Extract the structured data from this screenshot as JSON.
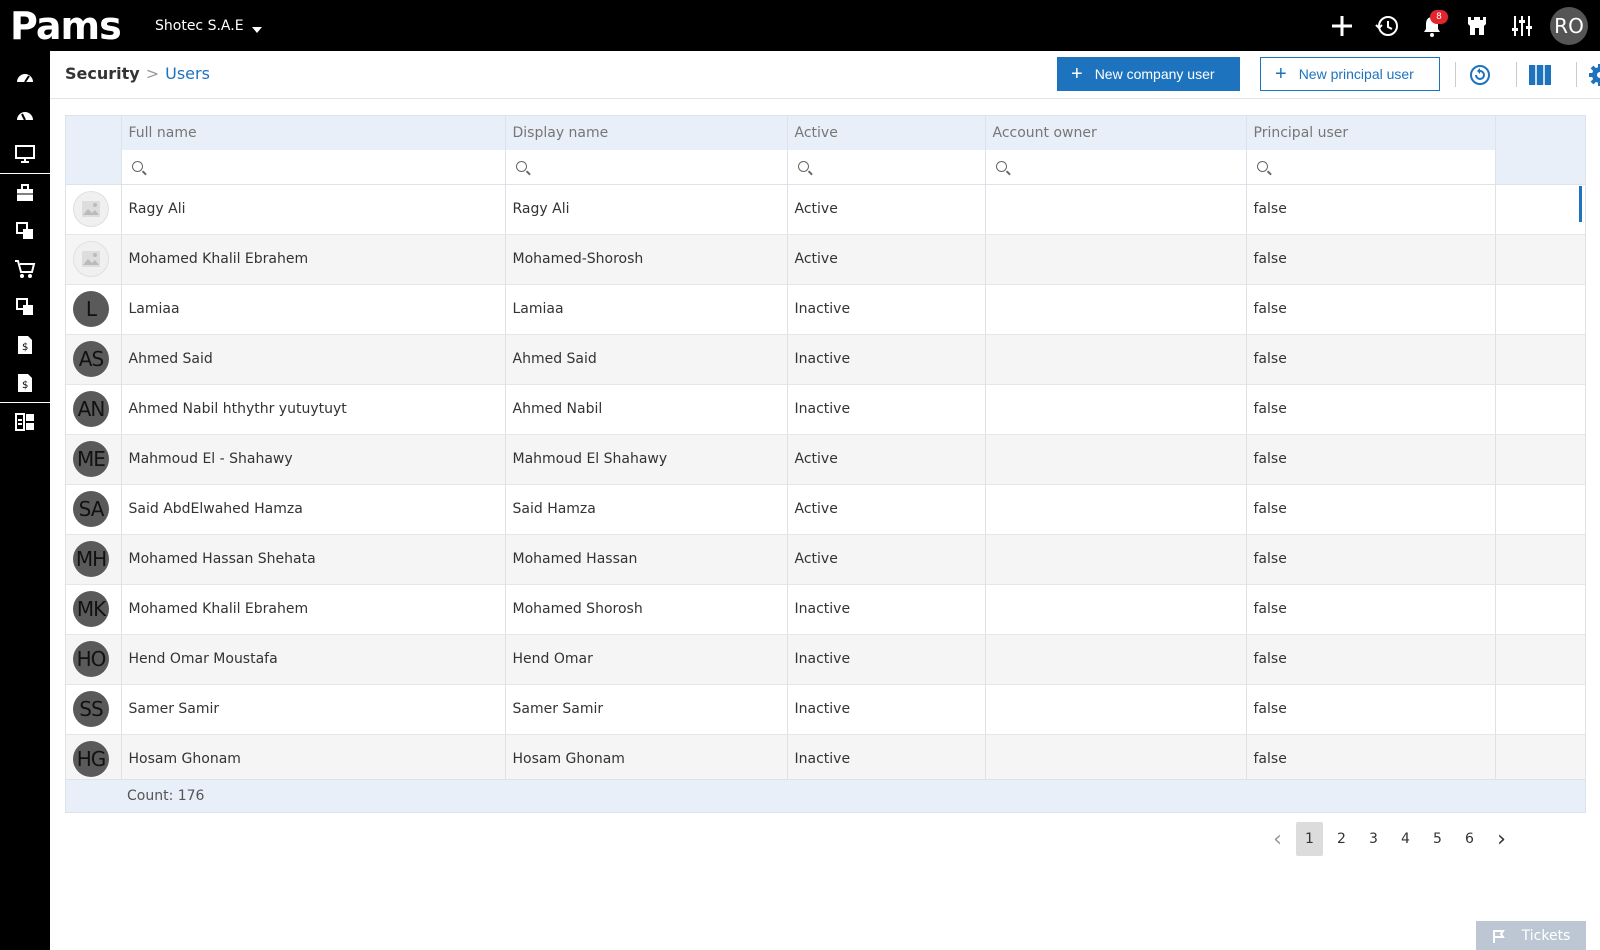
{
  "app": {
    "logo_text": "Pams",
    "company": "Shotec S.A.E",
    "notifications_count": "8",
    "user_initials": "RO"
  },
  "breadcrumb": {
    "root": "Security",
    "separator": ">",
    "current": "Users"
  },
  "toolbar": {
    "new_company_user": "New company user",
    "new_principal_user": "New principal user",
    "plus": "+"
  },
  "sidebar_icons": [
    "dashboard-icon",
    "dashboard-alt-icon",
    "monitor-icon",
    "briefcase-icon",
    "modules-icon",
    "cart-icon",
    "modules-alt-icon",
    "invoice-icon",
    "invoice-alt-icon",
    "widgets-icon"
  ],
  "table": {
    "columns": [
      "Full name",
      "Display name",
      "Active",
      "Account owner",
      "Principal user"
    ],
    "rows": [
      {
        "avatar": "",
        "avatar_type": "image",
        "full_name": "Ragy Ali",
        "display_name": "Ragy Ali",
        "active": "Active",
        "account_owner": "",
        "principal": "false"
      },
      {
        "avatar": "",
        "avatar_type": "image",
        "full_name": "Mohamed Khalil Ebrahem",
        "display_name": "Mohamed-Shorosh",
        "active": "Active",
        "account_owner": "",
        "principal": "false"
      },
      {
        "avatar": "L",
        "avatar_type": "initials",
        "full_name": "Lamiaa",
        "display_name": "Lamiaa",
        "active": "Inactive",
        "account_owner": "",
        "principal": "false"
      },
      {
        "avatar": "AS",
        "avatar_type": "initials",
        "full_name": "Ahmed Said",
        "display_name": "Ahmed Said",
        "active": "Inactive",
        "account_owner": "",
        "principal": "false"
      },
      {
        "avatar": "AN",
        "avatar_type": "initials",
        "full_name": "Ahmed Nabil hthythr yutuytuyt",
        "display_name": "Ahmed Nabil",
        "active": "Inactive",
        "account_owner": "",
        "principal": "false"
      },
      {
        "avatar": "ME",
        "avatar_type": "initials",
        "full_name": "Mahmoud El - Shahawy",
        "display_name": "Mahmoud El Shahawy",
        "active": "Active",
        "account_owner": "",
        "principal": "false"
      },
      {
        "avatar": "SA",
        "avatar_type": "initials",
        "full_name": "Said AbdElwahed Hamza",
        "display_name": "Said Hamza",
        "active": "Active",
        "account_owner": "",
        "principal": "false"
      },
      {
        "avatar": "MH",
        "avatar_type": "initials",
        "full_name": "Mohamed Hassan Shehata",
        "display_name": "Mohamed Hassan",
        "active": "Active",
        "account_owner": "",
        "principal": "false"
      },
      {
        "avatar": "MK",
        "avatar_type": "initials",
        "full_name": "Mohamed Khalil Ebrahem",
        "display_name": "Mohamed Shorosh",
        "active": "Inactive",
        "account_owner": "",
        "principal": "false"
      },
      {
        "avatar": "HO",
        "avatar_type": "initials",
        "full_name": "Hend Omar Moustafa",
        "display_name": "Hend Omar",
        "active": "Inactive",
        "account_owner": "",
        "principal": "false"
      },
      {
        "avatar": "SS",
        "avatar_type": "initials",
        "full_name": "Samer Samir",
        "display_name": "Samer Samir",
        "active": "Inactive",
        "account_owner": "",
        "principal": "false"
      },
      {
        "avatar": "HG",
        "avatar_type": "initials",
        "full_name": "Hosam Ghonam",
        "display_name": "Hosam Ghonam",
        "active": "Inactive",
        "account_owner": "",
        "principal": "false"
      }
    ],
    "count_label": "Count: 176"
  },
  "pagination": {
    "prev": "‹",
    "pages": [
      "1",
      "2",
      "3",
      "4",
      "5",
      "6"
    ],
    "active_page": "1",
    "next": "›"
  },
  "tickets_label": "Tickets",
  "colors": {
    "accent": "#1e73be",
    "topbar": "#000000",
    "badge": "#e3262e",
    "header_bg": "#e9eff8"
  }
}
